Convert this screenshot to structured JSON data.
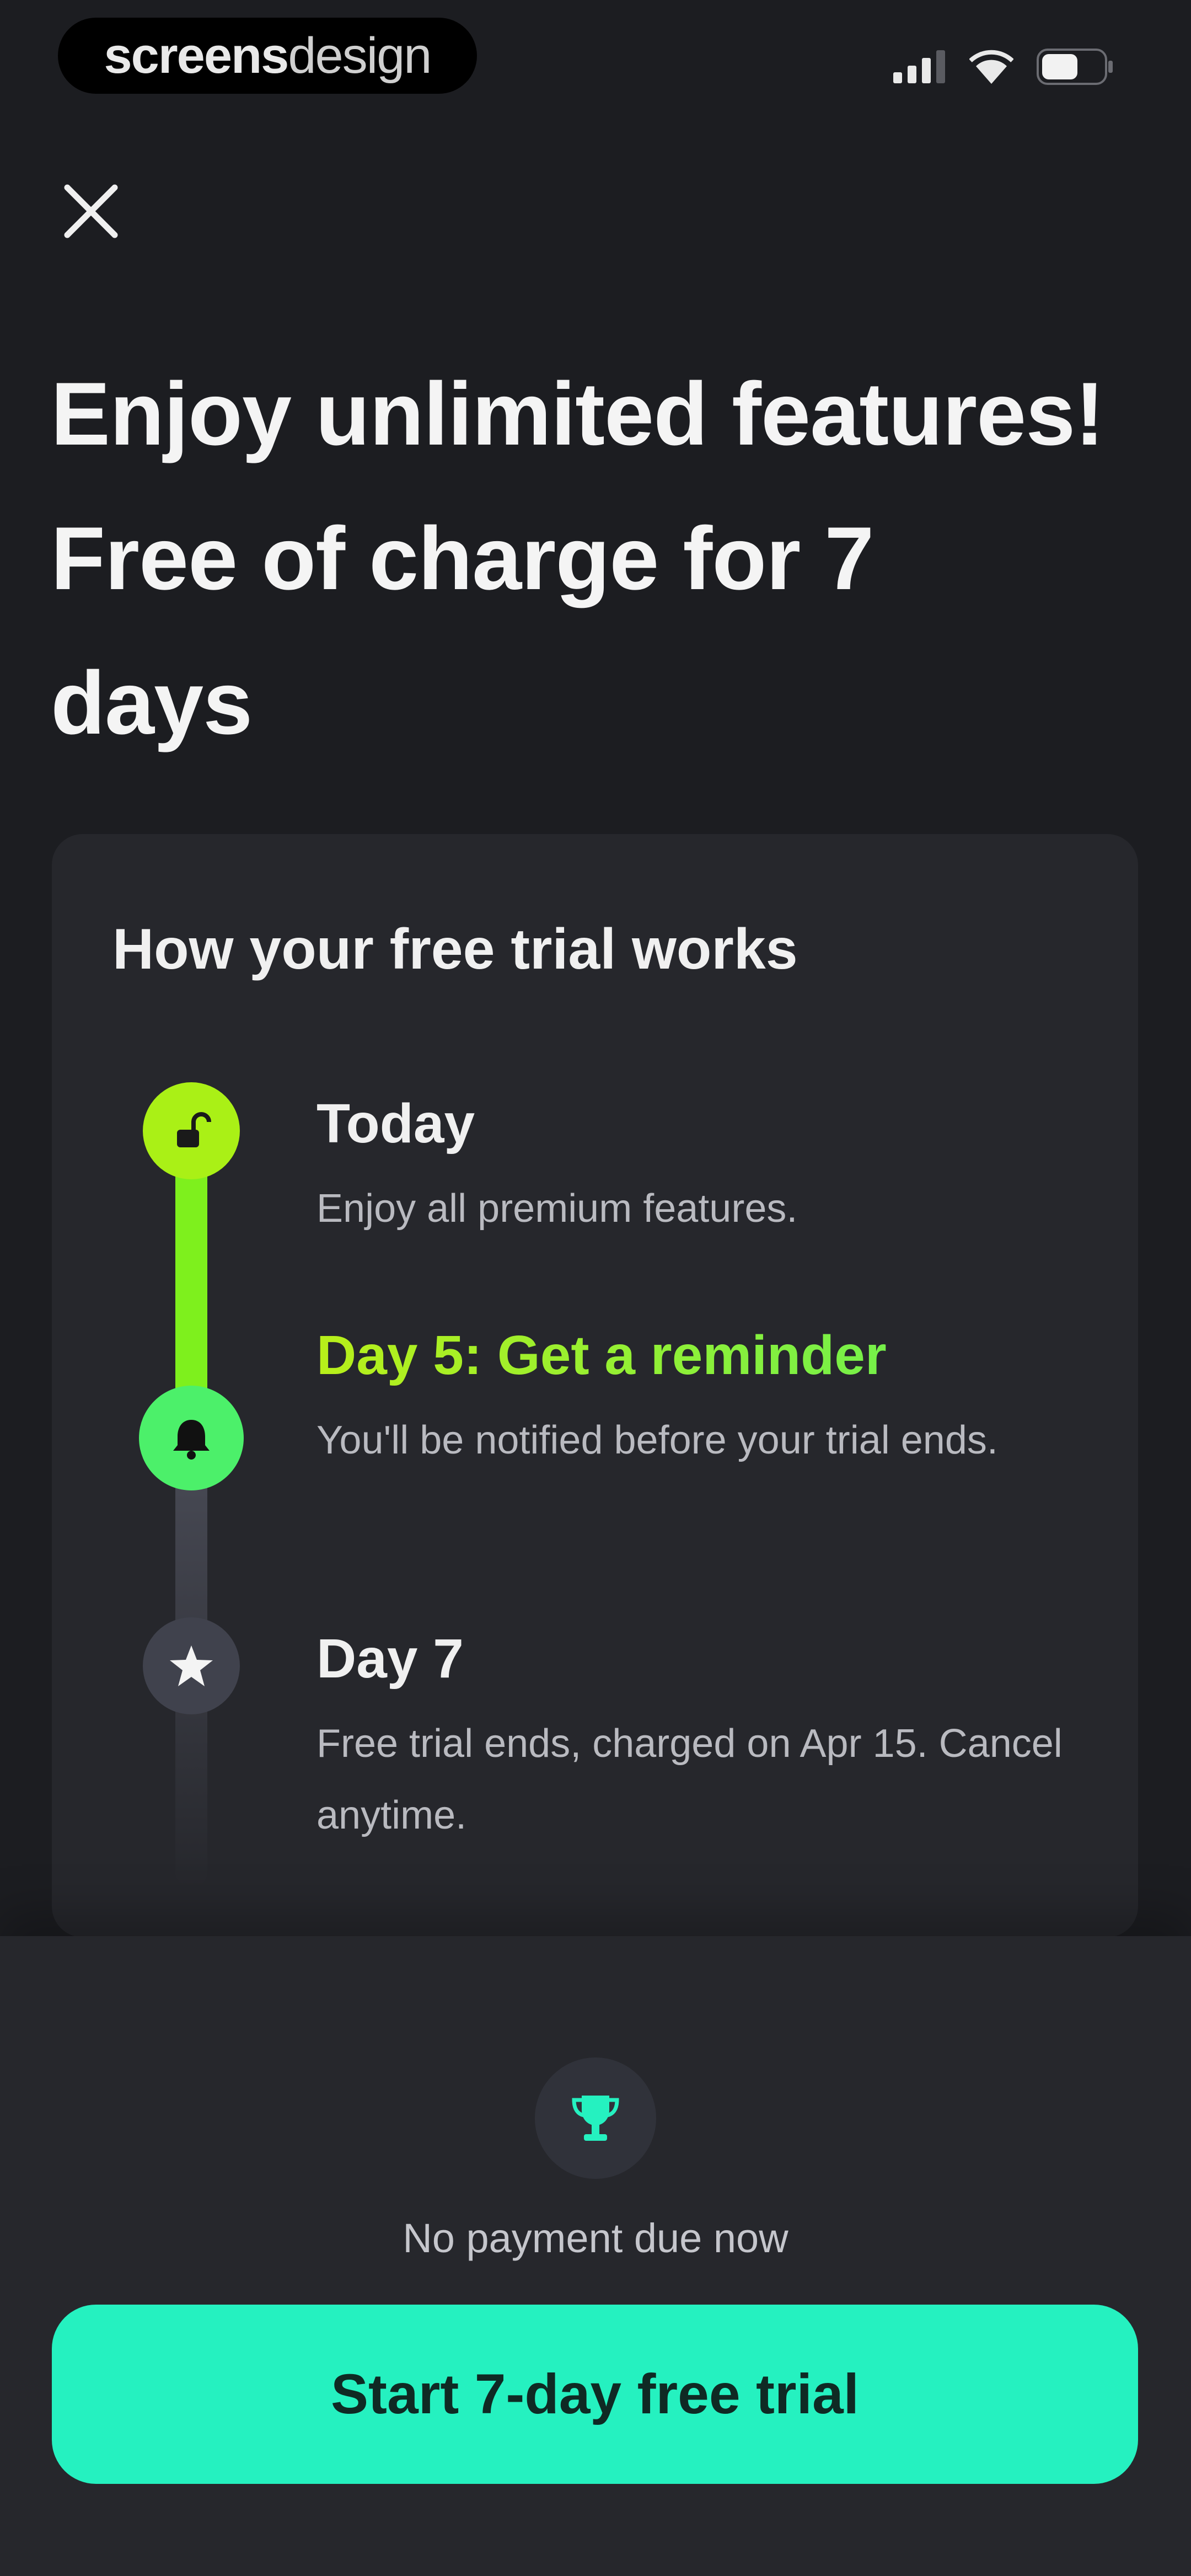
{
  "status_bar": {
    "brand_bold": "screens",
    "brand_light": "design",
    "icons": [
      "signal-icon",
      "wifi-icon",
      "battery-icon"
    ]
  },
  "header": {
    "close_icon": "close-icon",
    "headline": "Enjoy unlimited features!\nFree of charge for 7\ndays"
  },
  "trial_card": {
    "title": "How your free trial works",
    "steps": [
      {
        "icon": "unlock-icon",
        "title": "Today",
        "description": "Enjoy all premium features."
      },
      {
        "icon": "bell-icon",
        "title": "Day 5: Get a reminder",
        "description": "You'll be notified before your trial ends."
      },
      {
        "icon": "star-icon",
        "title": "Day 7",
        "description": "Free trial ends, charged on Apr 15. Cancel anytime."
      }
    ]
  },
  "footer": {
    "badge_icon": "trophy-icon",
    "note": "No payment due now",
    "cta_label": "Start 7-day free trial"
  },
  "colors": {
    "background": "#1c1d21",
    "card": "#26272c",
    "accent_lime": "#aaf016",
    "accent_green": "#4cf06a",
    "cta": "#25f1c0"
  }
}
